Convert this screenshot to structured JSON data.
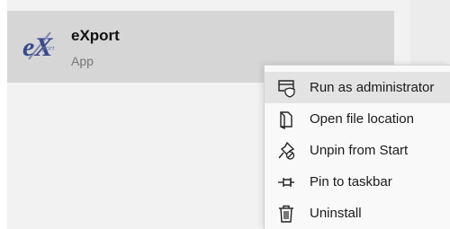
{
  "app": {
    "name": "eXport",
    "type": "App",
    "logo_text": "eX",
    "logo_small_text": "port"
  },
  "context_menu": {
    "items": [
      {
        "label": "Run as administrator",
        "icon": "shield-window-icon",
        "highlighted": true
      },
      {
        "label": "Open file location",
        "icon": "folder-icon",
        "highlighted": false
      },
      {
        "label": "Unpin from Start",
        "icon": "unpin-icon",
        "highlighted": false
      },
      {
        "label": "Pin to taskbar",
        "icon": "pin-icon",
        "highlighted": false
      },
      {
        "label": "Uninstall",
        "icon": "trash-icon",
        "highlighted": false
      }
    ]
  },
  "colors": {
    "logo_blue": "#3a4a8c",
    "highlight": "#e3e3e3",
    "app_row": "#d6d6d6"
  }
}
